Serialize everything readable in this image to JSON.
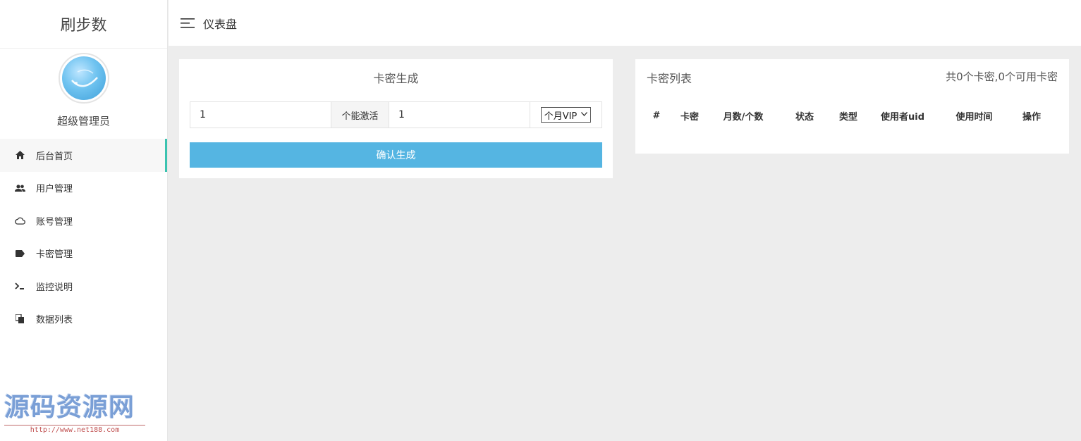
{
  "brand": "刷步数",
  "profile": {
    "role": "超级管理员"
  },
  "nav": [
    {
      "label": "后台首页",
      "icon": "home-icon",
      "active": true
    },
    {
      "label": "用户管理",
      "icon": "users-icon",
      "active": false
    },
    {
      "label": "账号管理",
      "icon": "cloud-icon",
      "active": false
    },
    {
      "label": "卡密管理",
      "icon": "tag-icon",
      "active": false
    },
    {
      "label": "监控说明",
      "icon": "terminal-icon",
      "active": false
    },
    {
      "label": "数据列表",
      "icon": "copy-icon",
      "active": false
    }
  ],
  "watermark": {
    "title": "源码资源网",
    "url": "http://www.net188.com"
  },
  "header": {
    "title": "仪表盘"
  },
  "generator": {
    "title": "卡密生成",
    "count_value": "1",
    "addon_label": "个能激活",
    "duration_value": "1",
    "type_selected": "个月VIP",
    "button_label": "确认生成"
  },
  "card_list": {
    "title": "卡密列表",
    "summary": "共0个卡密,0个可用卡密",
    "columns": [
      "#",
      "卡密",
      "月数/个数",
      "状态",
      "类型",
      "使用者uid",
      "使用时间",
      "操作"
    ]
  },
  "colors": {
    "accent": "#3ac3b0",
    "button": "#55b5e2",
    "background": "#ededed"
  }
}
